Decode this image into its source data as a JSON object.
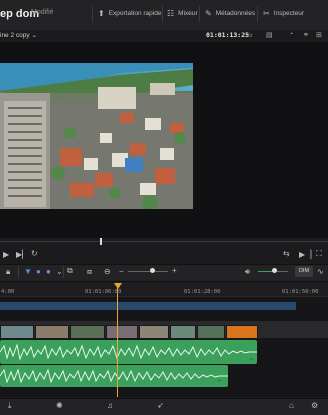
{
  "header": {
    "project_name": "ep dom",
    "project_status": "Modifié",
    "tabs": [
      {
        "label": "Exportation rapide",
        "icon": "export-icon"
      },
      {
        "label": "Mixeur",
        "icon": "mixer-icon"
      },
      {
        "label": "Métadonnées",
        "icon": "metadata-icon"
      },
      {
        "label": "Inspecteur",
        "icon": "inspector-icon"
      }
    ]
  },
  "subbar": {
    "timeline_name": "ine 2 copy",
    "timecode": "01:01:13:25"
  },
  "ruler": {
    "labels": [
      "4:00",
      "01:01:06:00",
      "01:01:28:00",
      "01:01:50:00"
    ]
  },
  "toolbar": {
    "dim_label": "DIM"
  },
  "colors": {
    "playhead": "#e8a63a",
    "audio_clip": "#3aa05b",
    "video_track_selected": "#2b4a6b",
    "orange_clip": "#d9741e"
  }
}
